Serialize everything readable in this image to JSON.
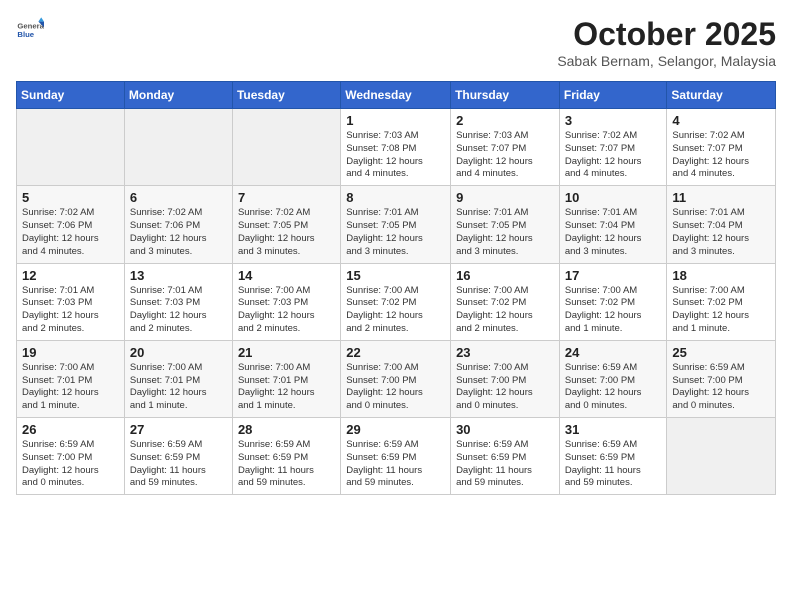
{
  "header": {
    "logo_general": "General",
    "logo_blue": "Blue",
    "title": "October 2025",
    "subtitle": "Sabak Bernam, Selangor, Malaysia"
  },
  "weekdays": [
    "Sunday",
    "Monday",
    "Tuesday",
    "Wednesday",
    "Thursday",
    "Friday",
    "Saturday"
  ],
  "weeks": [
    [
      {
        "date": "",
        "info": ""
      },
      {
        "date": "",
        "info": ""
      },
      {
        "date": "",
        "info": ""
      },
      {
        "date": "1",
        "info": "Sunrise: 7:03 AM\nSunset: 7:08 PM\nDaylight: 12 hours\nand 4 minutes."
      },
      {
        "date": "2",
        "info": "Sunrise: 7:03 AM\nSunset: 7:07 PM\nDaylight: 12 hours\nand 4 minutes."
      },
      {
        "date": "3",
        "info": "Sunrise: 7:02 AM\nSunset: 7:07 PM\nDaylight: 12 hours\nand 4 minutes."
      },
      {
        "date": "4",
        "info": "Sunrise: 7:02 AM\nSunset: 7:07 PM\nDaylight: 12 hours\nand 4 minutes."
      }
    ],
    [
      {
        "date": "5",
        "info": "Sunrise: 7:02 AM\nSunset: 7:06 PM\nDaylight: 12 hours\nand 4 minutes."
      },
      {
        "date": "6",
        "info": "Sunrise: 7:02 AM\nSunset: 7:06 PM\nDaylight: 12 hours\nand 3 minutes."
      },
      {
        "date": "7",
        "info": "Sunrise: 7:02 AM\nSunset: 7:05 PM\nDaylight: 12 hours\nand 3 minutes."
      },
      {
        "date": "8",
        "info": "Sunrise: 7:01 AM\nSunset: 7:05 PM\nDaylight: 12 hours\nand 3 minutes."
      },
      {
        "date": "9",
        "info": "Sunrise: 7:01 AM\nSunset: 7:05 PM\nDaylight: 12 hours\nand 3 minutes."
      },
      {
        "date": "10",
        "info": "Sunrise: 7:01 AM\nSunset: 7:04 PM\nDaylight: 12 hours\nand 3 minutes."
      },
      {
        "date": "11",
        "info": "Sunrise: 7:01 AM\nSunset: 7:04 PM\nDaylight: 12 hours\nand 3 minutes."
      }
    ],
    [
      {
        "date": "12",
        "info": "Sunrise: 7:01 AM\nSunset: 7:03 PM\nDaylight: 12 hours\nand 2 minutes."
      },
      {
        "date": "13",
        "info": "Sunrise: 7:01 AM\nSunset: 7:03 PM\nDaylight: 12 hours\nand 2 minutes."
      },
      {
        "date": "14",
        "info": "Sunrise: 7:00 AM\nSunset: 7:03 PM\nDaylight: 12 hours\nand 2 minutes."
      },
      {
        "date": "15",
        "info": "Sunrise: 7:00 AM\nSunset: 7:02 PM\nDaylight: 12 hours\nand 2 minutes."
      },
      {
        "date": "16",
        "info": "Sunrise: 7:00 AM\nSunset: 7:02 PM\nDaylight: 12 hours\nand 2 minutes."
      },
      {
        "date": "17",
        "info": "Sunrise: 7:00 AM\nSunset: 7:02 PM\nDaylight: 12 hours\nand 1 minute."
      },
      {
        "date": "18",
        "info": "Sunrise: 7:00 AM\nSunset: 7:02 PM\nDaylight: 12 hours\nand 1 minute."
      }
    ],
    [
      {
        "date": "19",
        "info": "Sunrise: 7:00 AM\nSunset: 7:01 PM\nDaylight: 12 hours\nand 1 minute."
      },
      {
        "date": "20",
        "info": "Sunrise: 7:00 AM\nSunset: 7:01 PM\nDaylight: 12 hours\nand 1 minute."
      },
      {
        "date": "21",
        "info": "Sunrise: 7:00 AM\nSunset: 7:01 PM\nDaylight: 12 hours\nand 1 minute."
      },
      {
        "date": "22",
        "info": "Sunrise: 7:00 AM\nSunset: 7:00 PM\nDaylight: 12 hours\nand 0 minutes."
      },
      {
        "date": "23",
        "info": "Sunrise: 7:00 AM\nSunset: 7:00 PM\nDaylight: 12 hours\nand 0 minutes."
      },
      {
        "date": "24",
        "info": "Sunrise: 6:59 AM\nSunset: 7:00 PM\nDaylight: 12 hours\nand 0 minutes."
      },
      {
        "date": "25",
        "info": "Sunrise: 6:59 AM\nSunset: 7:00 PM\nDaylight: 12 hours\nand 0 minutes."
      }
    ],
    [
      {
        "date": "26",
        "info": "Sunrise: 6:59 AM\nSunset: 7:00 PM\nDaylight: 12 hours\nand 0 minutes."
      },
      {
        "date": "27",
        "info": "Sunrise: 6:59 AM\nSunset: 6:59 PM\nDaylight: 11 hours\nand 59 minutes."
      },
      {
        "date": "28",
        "info": "Sunrise: 6:59 AM\nSunset: 6:59 PM\nDaylight: 11 hours\nand 59 minutes."
      },
      {
        "date": "29",
        "info": "Sunrise: 6:59 AM\nSunset: 6:59 PM\nDaylight: 11 hours\nand 59 minutes."
      },
      {
        "date": "30",
        "info": "Sunrise: 6:59 AM\nSunset: 6:59 PM\nDaylight: 11 hours\nand 59 minutes."
      },
      {
        "date": "31",
        "info": "Sunrise: 6:59 AM\nSunset: 6:59 PM\nDaylight: 11 hours\nand 59 minutes."
      },
      {
        "date": "",
        "info": ""
      }
    ]
  ]
}
